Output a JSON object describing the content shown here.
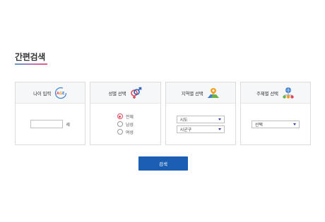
{
  "page": {
    "title": "간편검색"
  },
  "cards": {
    "age": {
      "label": "나이 입력",
      "input_value": "",
      "unit": "세"
    },
    "gender": {
      "label": "성별 선택",
      "options": [
        "전체",
        "남성",
        "여성"
      ],
      "selected": "전체"
    },
    "region": {
      "label": "지역별 선택",
      "select1": "시도",
      "select2": "시군구"
    },
    "topic": {
      "label": "주제별 선택",
      "select": "선택"
    }
  },
  "search_button": {
    "label": "검색",
    "color": "#1a5fb4"
  },
  "colors": {
    "accent_red": "#e0475b",
    "border": "#dcdcdc",
    "header_bg": "#f6f7f9"
  },
  "icons": {
    "age": "age-icon",
    "gender": "gender-symbol-icon",
    "region": "map-pin-icon",
    "topic": "network-icon"
  }
}
